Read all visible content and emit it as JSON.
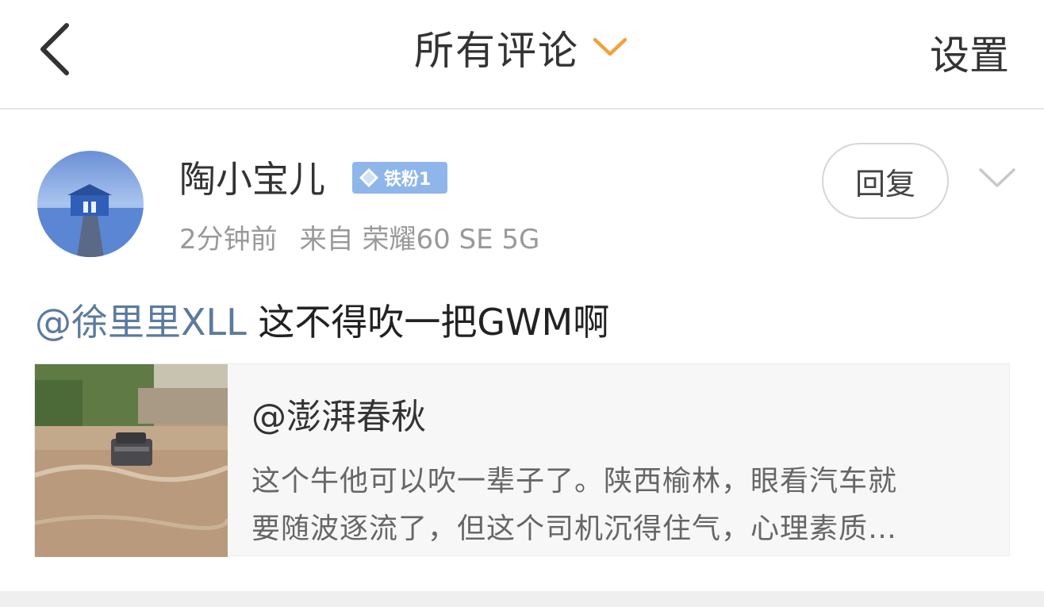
{
  "header": {
    "title": "所有评论",
    "settings_label": "设置",
    "accent_color": "#f0a23a"
  },
  "comment": {
    "username": "陶小宝儿",
    "fan_badge": "铁粉1",
    "time": "2分钟前",
    "source": "来自 荣耀60 SE 5G",
    "reply_label": "回复",
    "mention": "@徐里里XLL",
    "text": " 这不得吹一把GWM啊",
    "mention_color": "#5b7a9e"
  },
  "quote": {
    "author": "@澎湃春秋",
    "line1": "这个牛他可以吹一辈子了。陕西榆林，眼看汽车就",
    "line2": "要随波逐流了，但这个司机沉得住气，心理素质…"
  },
  "icons": {
    "back": "chevron-left-icon",
    "title_dropdown": "chevron-down-icon",
    "more": "chevron-down-icon",
    "badge": "diamond-icon"
  }
}
